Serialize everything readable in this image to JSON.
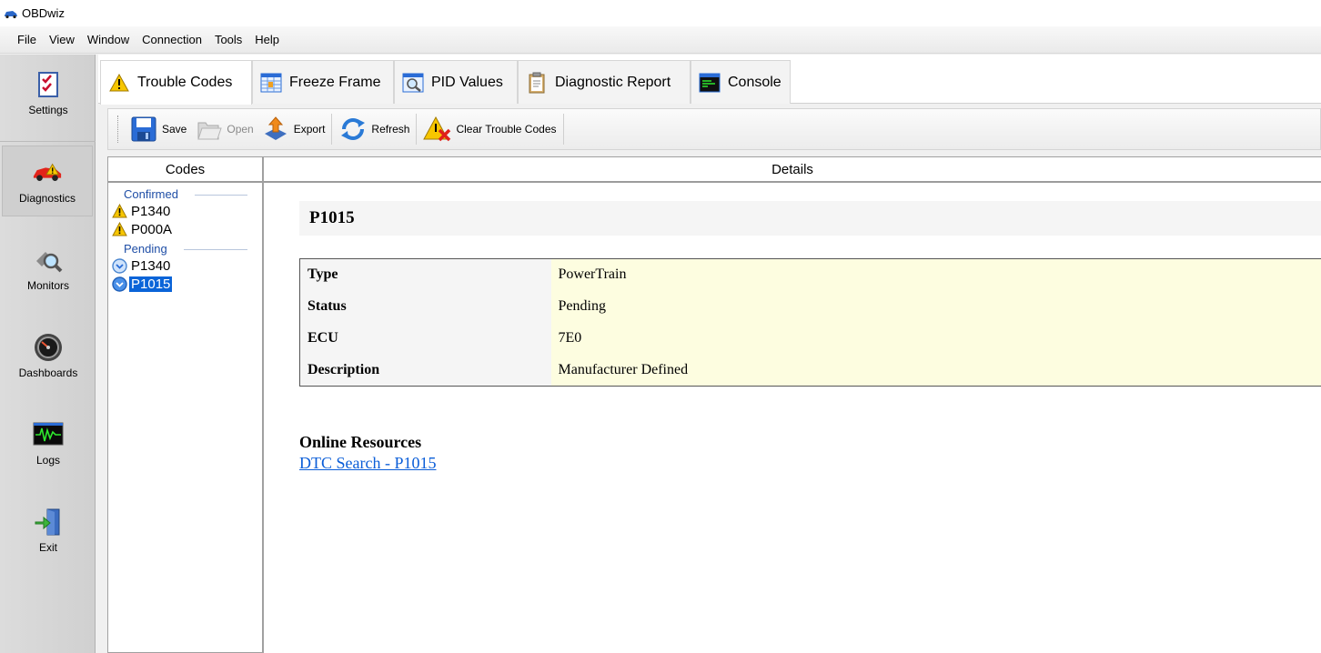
{
  "window": {
    "title": "OBDwiz"
  },
  "menu": [
    "File",
    "View",
    "Window",
    "Connection",
    "Tools",
    "Help"
  ],
  "sidebar": {
    "items": [
      {
        "label": "Settings",
        "icon": "checklist-icon"
      },
      {
        "label": "Diagnostics",
        "icon": "car-warning-icon",
        "active": true
      },
      {
        "label": "Monitors",
        "icon": "magnifier-icon"
      },
      {
        "label": "Dashboards",
        "icon": "gauge-icon"
      },
      {
        "label": "Logs",
        "icon": "waveform-icon"
      },
      {
        "label": "Exit",
        "icon": "exit-door-icon"
      }
    ]
  },
  "tabs": [
    {
      "label": "Trouble Codes",
      "icon": "warning-icon",
      "active": true
    },
    {
      "label": "Freeze Frame",
      "icon": "grid-icon"
    },
    {
      "label": "PID Values",
      "icon": "chart-magnifier-icon"
    },
    {
      "label": "Diagnostic Report",
      "icon": "clipboard-icon"
    },
    {
      "label": "Console",
      "icon": "terminal-icon"
    }
  ],
  "toolbar": {
    "save": "Save",
    "open": "Open",
    "export": "Export",
    "refresh": "Refresh",
    "clear": "Clear Trouble Codes"
  },
  "codes_panel": {
    "header": "Codes",
    "groups": [
      {
        "label": "Confirmed",
        "items": [
          "P1340",
          "P000A"
        ]
      },
      {
        "label": "Pending",
        "items": [
          "P1340",
          "P1015"
        ]
      }
    ],
    "selected": "P1015"
  },
  "details": {
    "header": "Details",
    "code": "P1015",
    "rows": [
      {
        "key": "Type",
        "value": "PowerTrain"
      },
      {
        "key": "Status",
        "value": "Pending"
      },
      {
        "key": "ECU",
        "value": "7E0"
      },
      {
        "key": "Description",
        "value": "Manufacturer Defined"
      }
    ],
    "resources_title": "Online Resources",
    "resources_link": "DTC Search - P1015"
  },
  "colors": {
    "selection": "#0a64d8",
    "link": "#0b5ed8",
    "group_label": "#1f4ea6",
    "value_bg": "#fdfde0"
  }
}
